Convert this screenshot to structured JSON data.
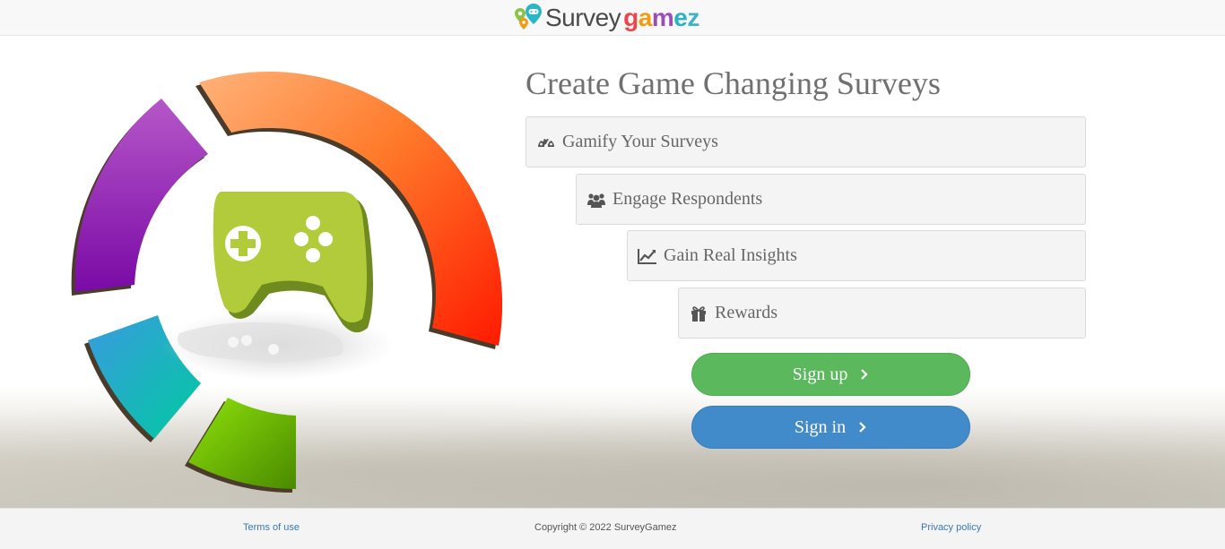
{
  "header": {
    "logo_part1": "Survey",
    "logo_part2_letters": [
      "g",
      "a",
      "m",
      "e",
      "z"
    ],
    "logo_part2_colors": [
      "#e8484d",
      "#f39c12",
      "#9b4fb5",
      "#27b3c0",
      "#3fb3c8"
    ]
  },
  "hero": {
    "title": "Create Game Changing Surveys",
    "features": [
      {
        "label": "Gamify Your Surveys",
        "icon": "dashboard-icon"
      },
      {
        "label": "Engage Respondents",
        "icon": "users-icon"
      },
      {
        "label": "Gain Real Insights",
        "icon": "line-chart-icon"
      },
      {
        "label": "Rewards",
        "icon": "gift-icon"
      }
    ]
  },
  "actions": {
    "signup_label": "Sign up",
    "signin_label": "Sign in",
    "chevron_icon": "chevron-right-icon"
  },
  "footer": {
    "terms_label": "Terms of use",
    "copyright_text": "Copyright © 2022 SurveyGamez",
    "privacy_label": "Privacy policy"
  },
  "colors": {
    "signup": "#5cb85c",
    "signin": "#428bca",
    "title": "#707070",
    "gamepad": "#a8c63a"
  }
}
